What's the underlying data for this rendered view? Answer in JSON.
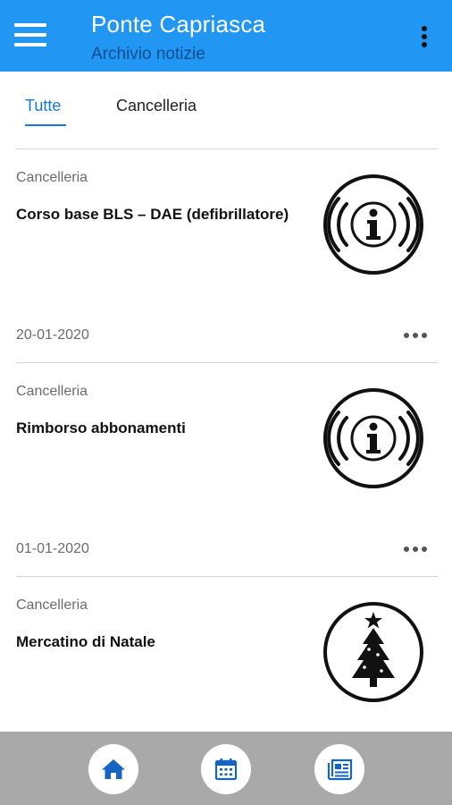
{
  "appbar": {
    "title": "Ponte Capriasca",
    "subtitle": "Archivio notizie",
    "menu_icon": "hamburger-menu-icon",
    "overflow_icon": "more-vert-icon",
    "background": "#2196f3"
  },
  "tabs": [
    {
      "label": "Tutte",
      "active": true
    },
    {
      "label": "Cancelleria",
      "active": false
    }
  ],
  "news": [
    {
      "category": "Cancelleria",
      "title": "Corso base BLS – DAE (defibrillatore)",
      "date": "20-01-2020",
      "icon": "info-icon"
    },
    {
      "category": "Cancelleria",
      "title": "Rimborso abbonamenti",
      "date": "01-01-2020",
      "icon": "info-icon"
    },
    {
      "category": "Cancelleria",
      "title": "Mercatino di Natale",
      "date": "",
      "icon": "christmas-tree-icon"
    }
  ],
  "bottom_nav": [
    {
      "icon": "home-icon"
    },
    {
      "icon": "calendar-icon"
    },
    {
      "icon": "newspaper-icon"
    }
  ],
  "colors": {
    "accent": "#1976d2",
    "bottom_bar": "#a9a9a9",
    "nav_icon": "#1565c0"
  }
}
